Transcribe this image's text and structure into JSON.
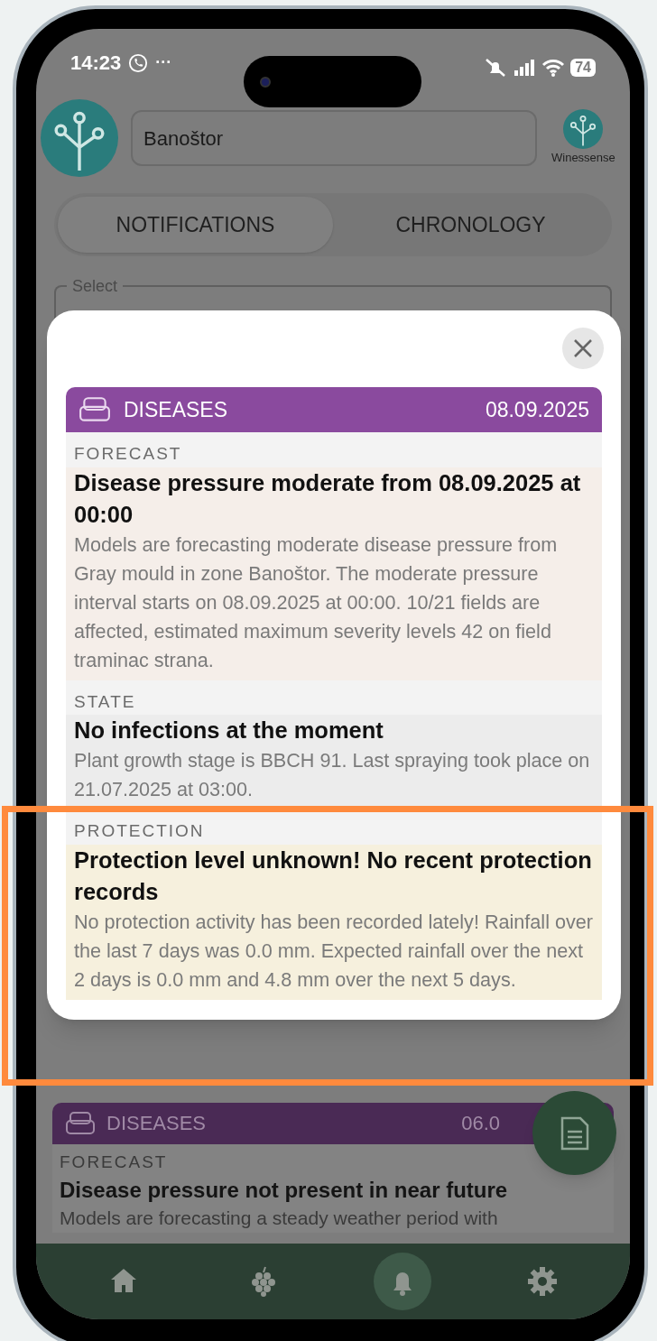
{
  "status_bar": {
    "time": "14:23",
    "more": "···",
    "battery": "74"
  },
  "header": {
    "location": "Banoštor",
    "brand": "Winessense"
  },
  "tabs": [
    {
      "label": "NOTIFICATIONS",
      "selected": true
    },
    {
      "label": "CHRONOLOGY",
      "selected": false
    }
  ],
  "select": {
    "label": "Select"
  },
  "modal": {
    "card": {
      "category": "DISEASES",
      "date": "08.09.2025",
      "sections": [
        {
          "kind": "forecast",
          "heading": "FORECAST",
          "title": "Disease pressure moderate from 08.09.2025 at 00:00",
          "body": "Models are forecasting moderate disease pressure from Gray mould in zone Banoštor. The moderate pressure interval starts on 08.09.2025 at 00:00. 10/21 fields are affected, estimated maximum severity levels 42 on field traminac strana."
        },
        {
          "kind": "state",
          "heading": "STATE",
          "title": "No infections at the moment",
          "body": "Plant growth stage is BBCH 91. Last spraying took place on 21.07.2025 at 03:00."
        },
        {
          "kind": "protection",
          "heading": "PROTECTION",
          "title": "Protection level unknown! No recent protection records",
          "body": "No protection activity has been recorded lately! Rainfall over the last 7 days was 0.0 mm. Expected rainfall over the next 2 days is 0.0 mm and 4.8 mm over the next 5 days."
        }
      ]
    }
  },
  "background_card": {
    "category": "DISEASES",
    "date": "06.0",
    "heading": "FORECAST",
    "title": "Disease pressure not present in near future",
    "body": "Models are forecasting a steady weather period with"
  },
  "bottom_nav": [
    {
      "kind": "home",
      "selected": false
    },
    {
      "kind": "grapes",
      "selected": false
    },
    {
      "kind": "bell",
      "selected": true
    },
    {
      "kind": "settings",
      "selected": false
    }
  ]
}
